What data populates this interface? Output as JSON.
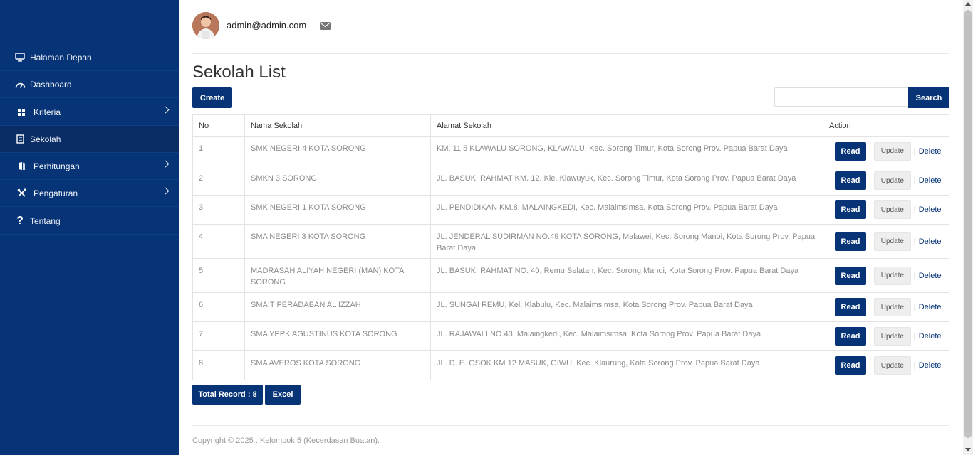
{
  "sidebar": {
    "items": [
      {
        "label": "Halaman Depan",
        "icon": "monitor-icon"
      },
      {
        "label": "Dashboard",
        "icon": "dashboard-gauge-icon"
      },
      {
        "label": "Kriteria",
        "icon": "grid-icon"
      },
      {
        "label": "Sekolah",
        "icon": "document-icon"
      },
      {
        "label": "Perhitungan",
        "icon": "book-icon"
      },
      {
        "label": "Pengaturan",
        "icon": "tools-icon"
      },
      {
        "label": "Tentang",
        "icon": "question-icon"
      }
    ],
    "active": "Sekolah"
  },
  "header": {
    "user_email": "admin@admin.com"
  },
  "page": {
    "title": "Sekolah List",
    "create_label": "Create",
    "search_placeholder": "",
    "search_label": "Search"
  },
  "table": {
    "headers": [
      "No",
      "Nama Sekolah",
      "Alamat Sekolah",
      "Action"
    ],
    "rows": [
      {
        "no": "1",
        "nama": "SMK NEGERI 4 KOTA SORONG",
        "alamat": "KM. 11,5 KLAWALU SORONG, KLAWALU, Kec. Sorong Timur, Kota Sorong Prov. Papua Barat Daya"
      },
      {
        "no": "2",
        "nama": "SMKN 3 SORONG",
        "alamat": "JL. BASUKI RAHMAT KM. 12, Kle. Klawuyuk, Kec. Sorong Timur, Kota Sorong Prov. Papua Barat Daya"
      },
      {
        "no": "3",
        "nama": "SMK NEGERI 1 KOTA SORONG",
        "alamat": "JL. PENDIDIKAN KM.8, MALAINGKEDI, Kec. Malaimsimsa, Kota Sorong Prov. Papua Barat Daya"
      },
      {
        "no": "4",
        "nama": "SMA NEGERI 3 KOTA SORONG",
        "alamat": "JL. JENDERAL SUDIRMAN NO.49 KOTA SORONG, Malawei, Kec. Sorong Manoi, Kota Sorong Prov. Papua Barat Daya"
      },
      {
        "no": "5",
        "nama": "MADRASAH ALIYAH NEGERI (MAN) KOTA SORONG",
        "alamat": "JL. BASUKI RAHMAT NO. 40, Remu Selatan, Kec. Sorong Manoi, Kota Sorong Prov. Papua Barat Daya"
      },
      {
        "no": "6",
        "nama": "SMAIT PERADABAN AL IZZAH",
        "alamat": "JL. SUNGAI REMU, Kel. Klabulu, Kec. Malaimsimsa, Kota Sorong Prov. Papua Barat Daya"
      },
      {
        "no": "7",
        "nama": "SMA YPPK AGUSTINUS KOTA SORONG",
        "alamat": "JL. RAJAWALI NO.43, Malaingkedi, Kec. Malaimsimsa, Kota Sorong Prov. Papua Barat Daya"
      },
      {
        "no": "8",
        "nama": "SMA AVEROS KOTA SORONG",
        "alamat": "JL. D. E. OSOK KM 12 MASUK, GIWU, Kec. Klaurung, Kota Sorong Prov. Papua Barat Daya"
      }
    ],
    "actions": {
      "read": "Read",
      "update": "Update",
      "delete": "Delete",
      "separator": "|"
    }
  },
  "summary": {
    "total_label": "Total Record : 8",
    "excel_label": "Excel"
  },
  "footer": {
    "text": "Copyright © 2025 . Kelompok 5 (Kecerdasan Buatan)."
  },
  "colors": {
    "sidebar_bg": "#073476",
    "primary": "#073476",
    "muted_text": "#8b8b8b"
  }
}
